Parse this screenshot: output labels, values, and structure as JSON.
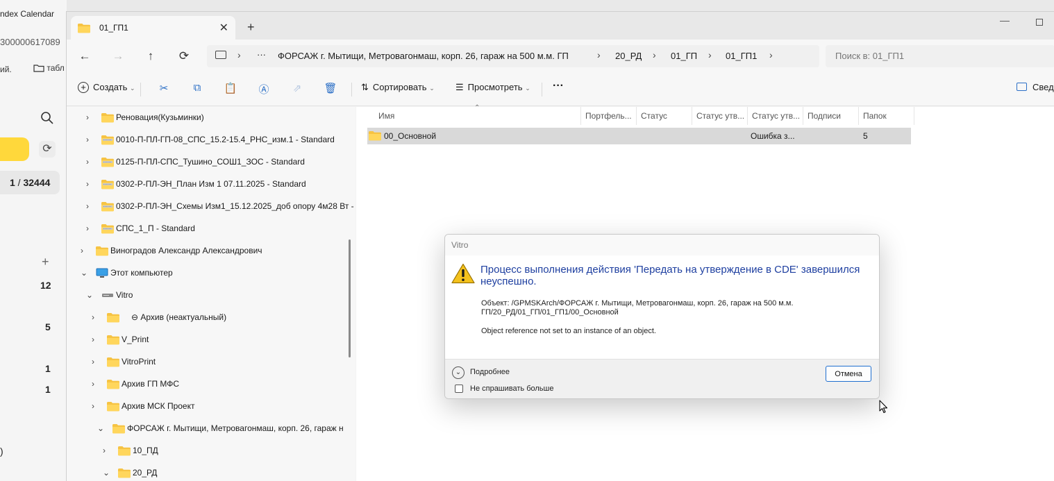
{
  "background_app": {
    "tab_title": "ndex Calendar",
    "url_fragment": "300000617089",
    "bookmark1": "ий.",
    "bookmark2": "табл",
    "counter_current": "1",
    "counter_sep": " / ",
    "counter_total": "32444",
    "side_numbers": [
      "12",
      "5",
      "1",
      "1"
    ],
    "paren": ")"
  },
  "explorer": {
    "tab_label": "01_ГП1",
    "breadcrumbs": [
      "ФОРСАЖ г. Мытищи, Метровагонмаш, корп. 26, гараж на 500 м.м. ГП",
      "20_РД",
      "01_ГП",
      "01_ГП1"
    ],
    "crumb_more": "···",
    "search_placeholder": "Поиск в: 01_ГП1",
    "toolbar": {
      "create": "Создать",
      "sort": "Сортировать",
      "view": "Просмотреть",
      "more": "···",
      "details": "Сведе"
    },
    "nav_tree": [
      {
        "label": "Реновация(Кузьминки)",
        "icon": "folder-icon"
      },
      {
        "label": "0010-П-ПЛ-ГП-08_СПС_15.2-15.4_РНС_изм.1 - Standard",
        "icon": "archive-folder-icon"
      },
      {
        "label": "0125-П-ПЛ-СПС_Тушино_СОШ1_ЗОС - Standard",
        "icon": "archive-folder-icon"
      },
      {
        "label": "0302-Р-ПЛ-ЭН_План Изм 1 07.11.2025 - Standard",
        "icon": "archive-folder-icon"
      },
      {
        "label": "0302-Р-ПЛ-ЭН_Схемы Изм1_15.12.2025_доб опору 4м28 Вт -",
        "icon": "archive-folder-icon"
      },
      {
        "label": "СПС_1_П - Standard",
        "icon": "archive-folder-icon"
      },
      {
        "label": "Виноградов Александр Александрович",
        "icon": "folder-icon"
      },
      {
        "label": "Этот компьютер",
        "icon": "computer-icon"
      },
      {
        "label": "Vitro",
        "icon": "drive-icon"
      },
      {
        "label": "⊖ Архив (неактуальный)",
        "icon": "folder-icon"
      },
      {
        "label": "V_Print",
        "icon": "folder-icon"
      },
      {
        "label": "VitroPrint",
        "icon": "folder-icon"
      },
      {
        "label": "Архив ГП МФС",
        "icon": "folder-icon"
      },
      {
        "label": "Архив МСК Проект",
        "icon": "folder-icon"
      },
      {
        "label": "ФОРСАЖ г. Мытищи, Метровагонмаш, корп. 26, гараж н",
        "icon": "folder-icon"
      },
      {
        "label": "10_ПД",
        "icon": "folder-icon"
      },
      {
        "label": "20_РД",
        "icon": "folder-icon"
      }
    ],
    "columns": [
      "Имя",
      "Портфель...",
      "Статус",
      "Статус утв...",
      "Статус утв...",
      "Подписи",
      "Папок"
    ],
    "rows": [
      {
        "name": "00_Основной",
        "portfolio": "",
        "status": "",
        "approval1": "",
        "approval2": "Ошибка з...",
        "signatures": "",
        "folders": "5"
      }
    ]
  },
  "dialog": {
    "title": "Vitro",
    "heading": "Процесс выполнения действия 'Передать на утверждение в CDE' завершился неуспешно.",
    "object_line1": "Объект: /GPMSKArch/ФОРСАЖ г. Мытищи, Метровагонмаш, корп. 26, гараж на 500 м.м.",
    "object_line2": "ГП/20_РД/01_ГП/01_ГП1/00_Основной",
    "error_text": "Object reference not set to an instance of an object.",
    "more_label": "Подробнее",
    "dont_ask_label": "Не спрашивать больше",
    "cancel_label": "Отмена"
  },
  "colors": {
    "accent": "#1f6fd0",
    "heading": "#1e3fa0",
    "folder": "#f6c343",
    "selected_row": "#d9d9d9"
  }
}
